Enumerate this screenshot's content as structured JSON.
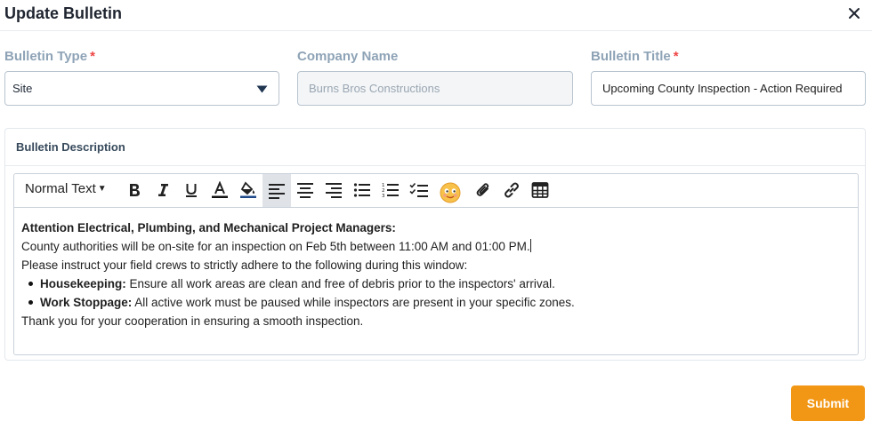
{
  "dialog": {
    "title": "Update Bulletin",
    "close_icon": "close-icon"
  },
  "form": {
    "bulletin_type": {
      "label": "Bulletin Type",
      "required_mark": "*",
      "value": "Site"
    },
    "company_name": {
      "label": "Company Name",
      "value": "Burns Bros Constructions"
    },
    "bulletin_title": {
      "label": "Bulletin Title",
      "required_mark": "*",
      "value": "Upcoming County Inspection - Action Required"
    }
  },
  "description": {
    "label": "Bulletin Description",
    "toolbar": {
      "text_style": "Normal Text",
      "buttons": [
        "bold-icon",
        "italic-icon",
        "underline-icon",
        "text-color-icon",
        "fill-color-icon",
        "align-left-icon",
        "align-center-icon",
        "align-right-icon",
        "bulleted-list-icon",
        "numbered-list-icon",
        "checklist-icon",
        "emoji-icon",
        "attachment-icon",
        "link-icon",
        "table-icon"
      ],
      "active": "align-left-icon"
    },
    "content": {
      "heading": "Attention Electrical, Plumbing, and Mechanical Project Managers:",
      "line1": "County authorities will be on-site for an inspection on Feb 5th between 11:00 AM and 01:00 PM.",
      "line2": "Please instruct your field crews to strictly adhere to the following during this window:",
      "bullets": [
        {
          "label": "Housekeeping:",
          "text": " Ensure all work areas are clean and free of debris prior to the inspectors' arrival."
        },
        {
          "label": "Work Stoppage:",
          "text": " All active work must be paused while inspectors are present in your specific zones."
        }
      ],
      "closing": "Thank you for your cooperation in ensuring a smooth inspection."
    }
  },
  "actions": {
    "submit_label": "Submit"
  },
  "colors": {
    "accent": "#f29715",
    "label": "#8ea3b6",
    "required": "#ef4444"
  }
}
